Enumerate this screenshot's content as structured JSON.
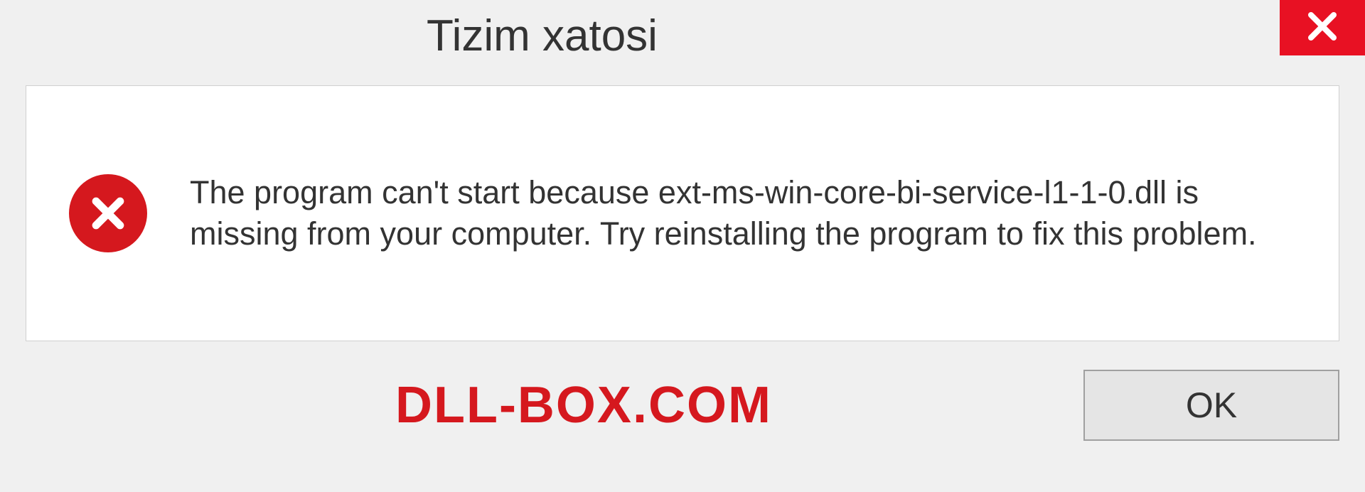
{
  "dialog": {
    "title": "Tizim xatosi",
    "message": "The program can't start because ext-ms-win-core-bi-service-l1-1-0.dll is missing from your computer. Try reinstalling the program to fix this problem.",
    "ok_label": "OK"
  },
  "branding": {
    "watermark": "DLL-BOX.COM"
  }
}
